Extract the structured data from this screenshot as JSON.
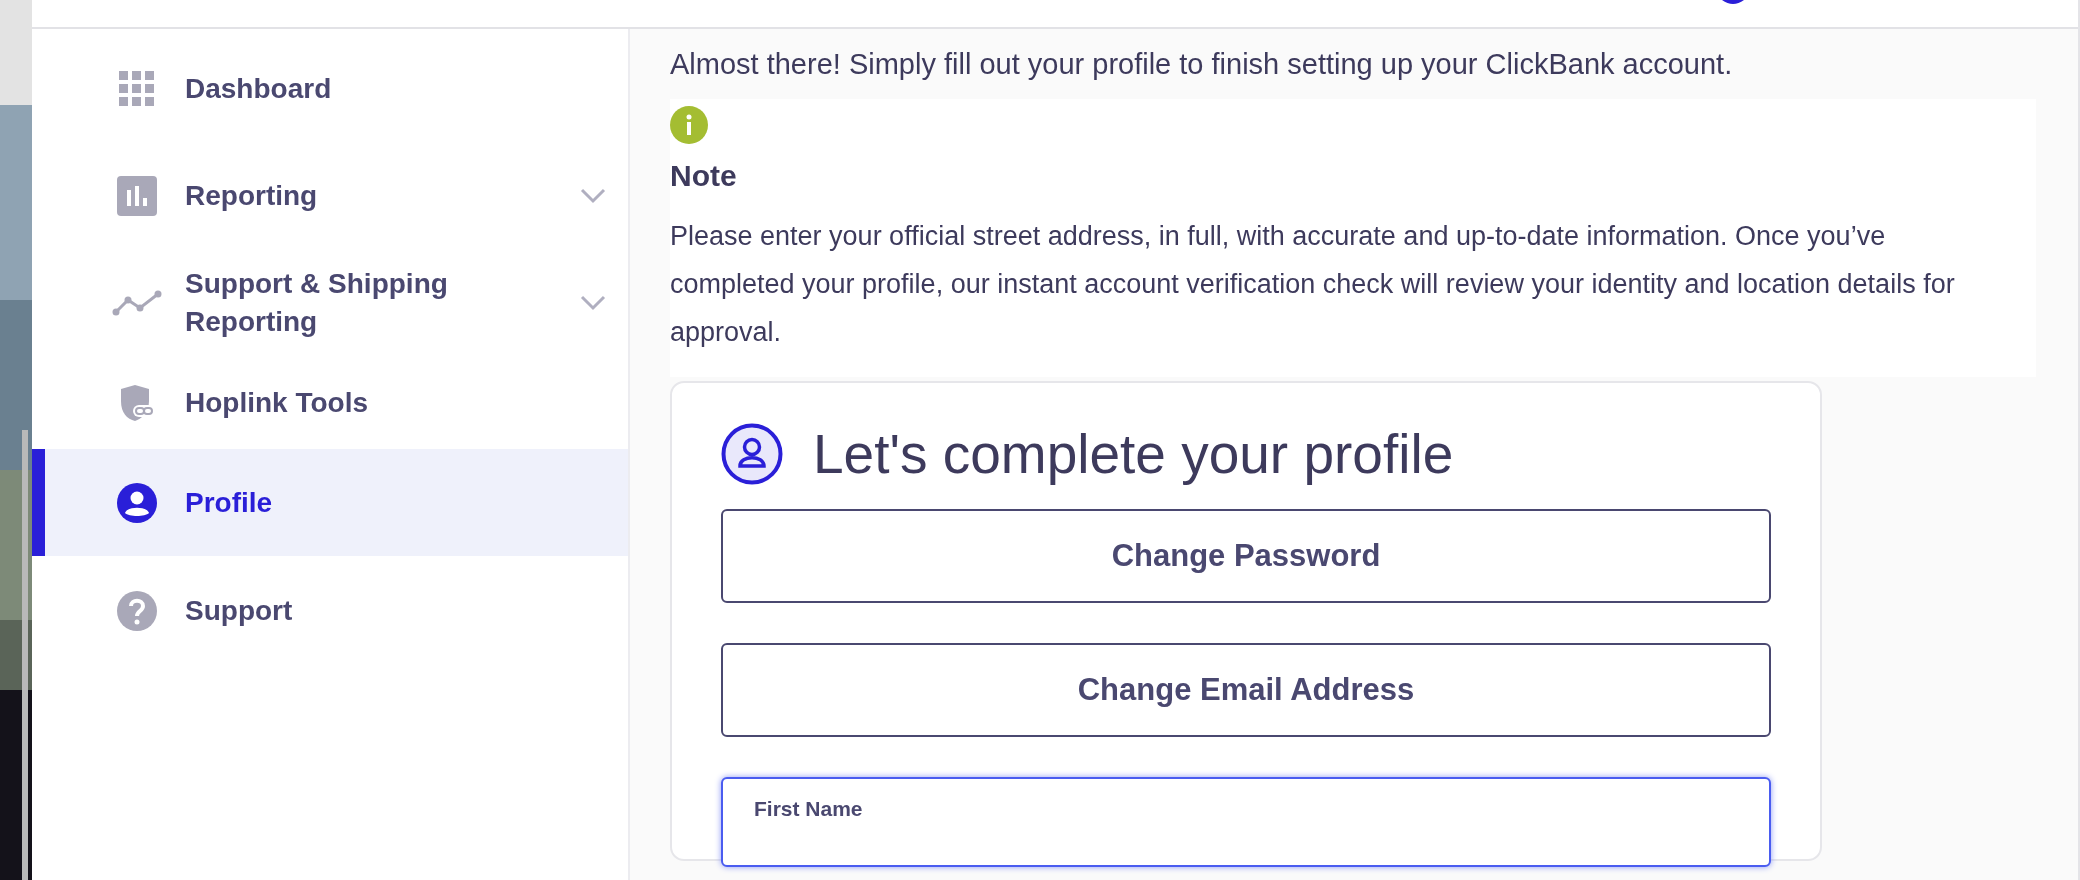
{
  "sidebar": {
    "items": [
      {
        "label": "Dashboard",
        "kind": "link",
        "selected": false
      },
      {
        "label": "Reporting",
        "kind": "group",
        "expanded": false,
        "selected": false
      },
      {
        "label": "Support & Shipping Reporting",
        "kind": "group",
        "expanded": false,
        "selected": false
      },
      {
        "label": "Hoplink Tools",
        "kind": "link",
        "selected": false
      },
      {
        "label": "Profile",
        "kind": "link",
        "selected": true
      },
      {
        "label": "Support",
        "kind": "link",
        "selected": false
      }
    ]
  },
  "intro": "Almost there! Simply fill out your profile to finish setting up your ClickBank account.",
  "note": {
    "title": "Note",
    "text": "Please enter your official street address, in full, with accurate and up-to-date information. Once you’ve completed your profile, our instant account verification check will review your identity and location details for approval."
  },
  "profile_card": {
    "title": "Let's complete your profile",
    "buttons": [
      "Change Password",
      "Change Email Address"
    ],
    "fields": [
      {
        "label": "First Name",
        "focused": true
      }
    ]
  }
}
